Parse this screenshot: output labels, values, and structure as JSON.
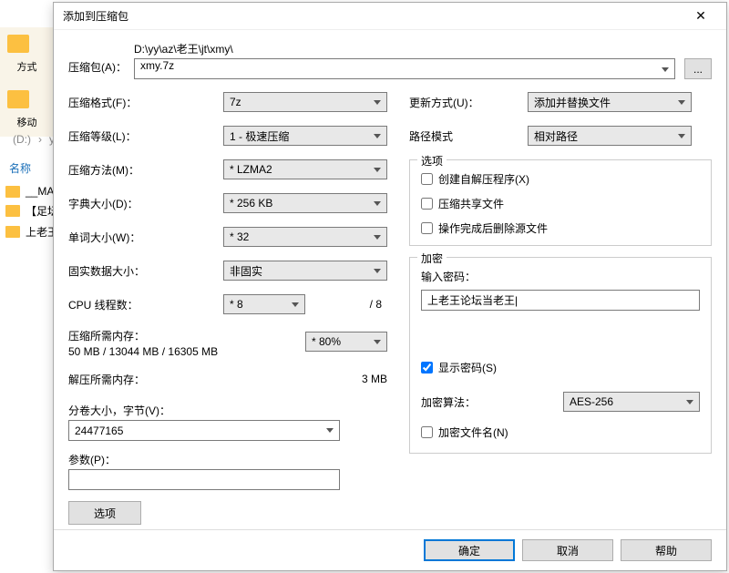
{
  "bg": {
    "viewmode": "方式",
    "moveto": "移动",
    "drive": "(D:)",
    "folder": "yy",
    "nameHeader": "名称",
    "items": [
      "__MA",
      "【足坛",
      "上老王"
    ]
  },
  "dialog": {
    "title": "添加到压缩包",
    "archiveLabel": "压缩包(A)：",
    "archivePath": "D:\\yy\\az\\老王\\jt\\xmy\\",
    "archiveName": "xmy.7z",
    "browseBtn": "...",
    "left": {
      "format": {
        "label": "压缩格式(F)：",
        "value": "7z"
      },
      "level": {
        "label": "压缩等级(L)：",
        "value": "1 - 极速压缩"
      },
      "method": {
        "label": "压缩方法(M)：",
        "value": "* LZMA2"
      },
      "dict": {
        "label": "字典大小(D)：",
        "value": "* 256 KB"
      },
      "word": {
        "label": "单词大小(W)：",
        "value": "* 32"
      },
      "solid": {
        "label": "固实数据大小：",
        "value": "非固实"
      },
      "threads": {
        "label": "CPU 线程数：",
        "value": "* 8",
        "max": "/ 8"
      },
      "memComp": {
        "label": "压缩所需内存：",
        "value": "50 MB / 13044 MB / 16305 MB",
        "pct": "* 80%"
      },
      "memDecomp": {
        "label": "解压所需内存：",
        "value": "3 MB"
      },
      "volume": {
        "label": "分卷大小，字节(V)：",
        "value": "24477165"
      },
      "params": {
        "label": "参数(P)：",
        "value": ""
      },
      "optionsBtn": "选项"
    },
    "right": {
      "update": {
        "label": "更新方式(U)：",
        "value": "添加并替换文件"
      },
      "pathMode": {
        "label": "路径模式",
        "value": "相对路径"
      },
      "optionsLegend": "选项",
      "opts": {
        "sfx": "创建自解压程序(X)",
        "share": "压缩共享文件",
        "deleteAfter": "操作完成后删除源文件"
      },
      "encLegend": "加密",
      "pwdLabel": "输入密码：",
      "pwdValue": "上老王论坛当老王|",
      "showPwd": "显示密码(S)",
      "encMethod": {
        "label": "加密算法：",
        "value": "AES-256"
      },
      "encNames": "加密文件名(N)"
    },
    "buttons": {
      "ok": "确定",
      "cancel": "取消",
      "help": "帮助"
    }
  }
}
